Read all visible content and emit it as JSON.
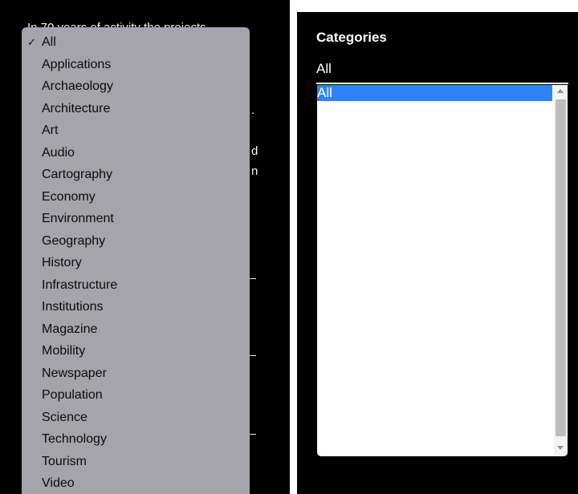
{
  "background": {
    "intro_text": "In 70 years of activity the projects",
    "fragments": [
      ".",
      "d",
      "n"
    ]
  },
  "menu": {
    "checkmark": "✓",
    "items": [
      {
        "label": "All",
        "selected": true
      },
      {
        "label": "Applications",
        "selected": false
      },
      {
        "label": "Archaeology",
        "selected": false
      },
      {
        "label": "Architecture",
        "selected": false
      },
      {
        "label": "Art",
        "selected": false
      },
      {
        "label": "Audio",
        "selected": false
      },
      {
        "label": "Cartography",
        "selected": false
      },
      {
        "label": "Economy",
        "selected": false
      },
      {
        "label": "Environment",
        "selected": false
      },
      {
        "label": "Geography",
        "selected": false
      },
      {
        "label": "History",
        "selected": false
      },
      {
        "label": "Infrastructure",
        "selected": false
      },
      {
        "label": "Institutions",
        "selected": false
      },
      {
        "label": "Magazine",
        "selected": false
      },
      {
        "label": "Mobility",
        "selected": false
      },
      {
        "label": "Newspaper",
        "selected": false
      },
      {
        "label": "Population",
        "selected": false
      },
      {
        "label": "Science",
        "selected": false
      },
      {
        "label": "Technology",
        "selected": false
      },
      {
        "label": "Tourism",
        "selected": false
      },
      {
        "label": "Video",
        "selected": false
      }
    ]
  },
  "right": {
    "title": "Categories",
    "current_value": "All",
    "listbox_selected": "All"
  },
  "colors": {
    "menu_bg": "#a6a4ab",
    "highlight": "#2f84f5",
    "panel_bg": "#000000"
  }
}
